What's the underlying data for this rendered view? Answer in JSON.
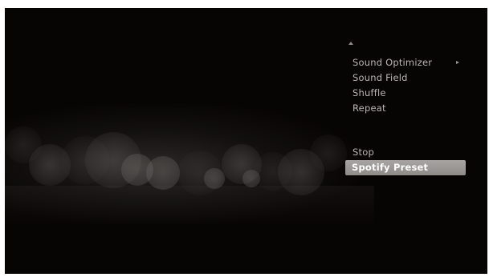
{
  "menu": {
    "items": [
      {
        "label": "Sound Optimizer",
        "has_submenu": true
      },
      {
        "label": "Sound Field",
        "has_submenu": false
      },
      {
        "label": "Shuffle",
        "has_submenu": false
      },
      {
        "label": "Repeat",
        "has_submenu": false
      },
      {
        "label": "Stop",
        "has_submenu": false
      },
      {
        "label": "Spotify Preset",
        "has_submenu": false,
        "selected": true
      }
    ],
    "scroll_up_indicator": "chevron-up-icon",
    "submenu_indicator": "chevron-right-icon"
  },
  "colors": {
    "background": "#070404",
    "menu_text": "#b9b6b3",
    "selected_background": "#9e9b98",
    "selected_text": "#ffffff"
  }
}
